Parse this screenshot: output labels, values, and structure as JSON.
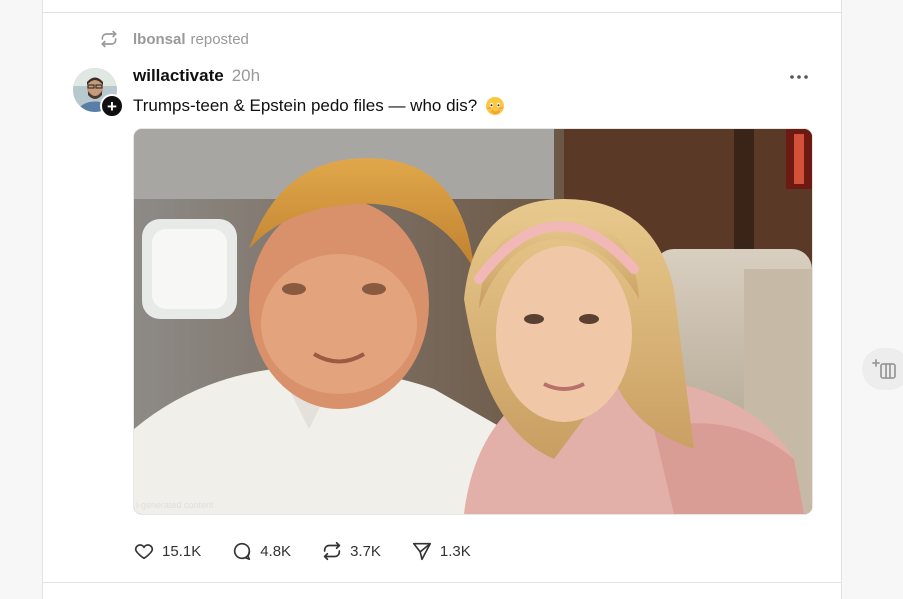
{
  "repost": {
    "reposter": "lbonsal",
    "label": "reposted",
    "icon": "repost-icon"
  },
  "post": {
    "author": "willactivate",
    "time": "20h",
    "text": "Trumps-teen & Epstein pedo files — who dis?",
    "emoji": "flushed-hand-over-mouth-emoji",
    "follow_badge": "+",
    "media": {
      "icon": "photo",
      "ai_label": "i-generated content"
    },
    "actions": [
      {
        "name": "like",
        "icon": "heart-icon",
        "count": "15.1K"
      },
      {
        "name": "reply",
        "icon": "comment-icon",
        "count": "4.8K"
      },
      {
        "name": "repost",
        "icon": "repost-icon",
        "count": "3.7K"
      },
      {
        "name": "share",
        "icon": "send-icon",
        "count": "1.3K"
      }
    ]
  },
  "colors": {
    "text": "#101010",
    "muted": "#999999",
    "divider": "#e3e3e3",
    "background": "#f7f7f7"
  }
}
